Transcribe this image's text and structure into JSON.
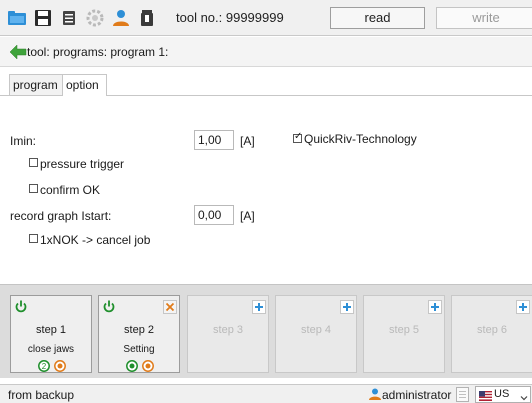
{
  "toolbar": {
    "tool_label": "tool no.: 99999999",
    "read_label": "read",
    "write_label": "write",
    "icons": [
      "folder-open-icon",
      "save-icon",
      "list-icon",
      "gear-icon",
      "user-tools-icon",
      "trash-icon"
    ]
  },
  "breadcrumb": {
    "text": "tool: programs: program 1:"
  },
  "tabs": [
    {
      "label": "program",
      "active": false
    },
    {
      "label": "option",
      "active": true
    }
  ],
  "options": {
    "imin_label": "Imin:",
    "imin_value": "1,00",
    "imin_unit": "[A]",
    "quickriv_label": "QuickRiv-Technology",
    "quickriv_checked": true,
    "pressure_trigger_label": "pressure trigger",
    "pressure_trigger_checked": false,
    "confirm_ok_label": "confirm OK",
    "confirm_ok_checked": false,
    "record_graph_label": "record graph Istart:",
    "record_graph_value": "0,00",
    "record_graph_unit": "[A]",
    "nok_cancel_label": "1xNOK -> cancel job",
    "nok_cancel_checked": false
  },
  "steps": [
    {
      "name": "step 1",
      "desc": "close jaws",
      "state": "active"
    },
    {
      "name": "step 2",
      "desc": "Setting",
      "state": "active"
    },
    {
      "name": "step 3",
      "desc": "",
      "state": "empty"
    },
    {
      "name": "step 4",
      "desc": "",
      "state": "empty"
    },
    {
      "name": "step 5",
      "desc": "",
      "state": "empty"
    },
    {
      "name": "step 6",
      "desc": "",
      "state": "empty"
    }
  ],
  "status": {
    "left_text": "from backup",
    "user_label": "administrator",
    "language": "US"
  },
  "colors": {
    "accent_blue": "#2e8fd6",
    "power_green": "#1f8f2c",
    "orange": "#e07b1a"
  }
}
